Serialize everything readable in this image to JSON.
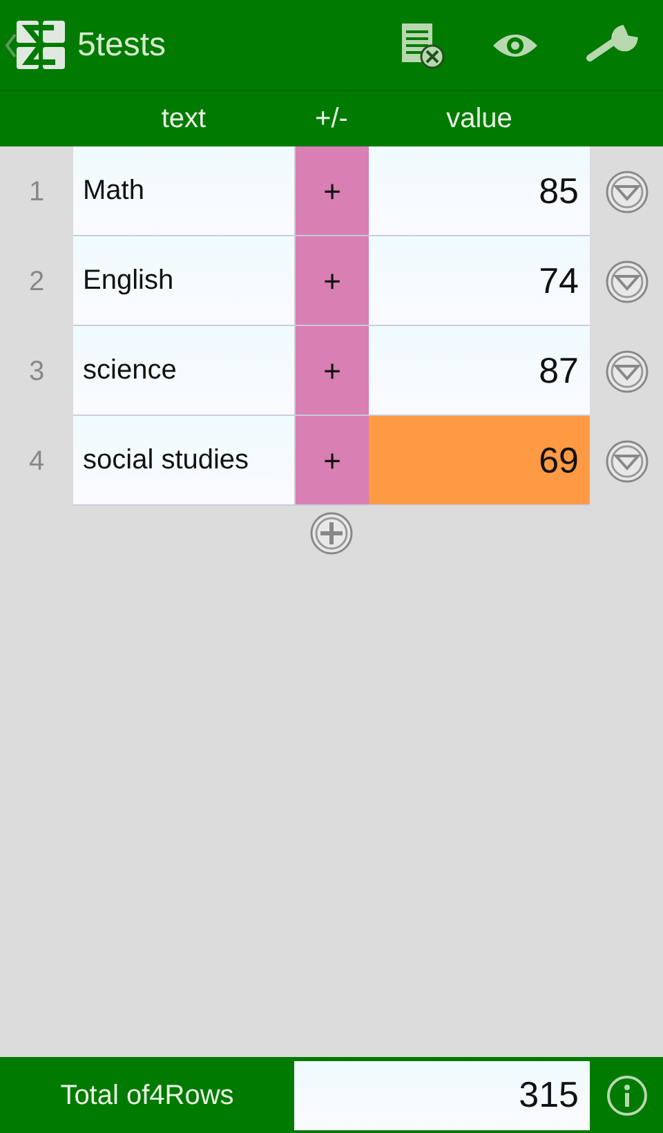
{
  "app_bar": {
    "title": "5tests"
  },
  "columns": [
    "text",
    "+/-",
    "value"
  ],
  "rows": [
    {
      "number": "1",
      "text": "Math",
      "sign": "+",
      "value": "85",
      "highlighted": false
    },
    {
      "number": "2",
      "text": "English",
      "sign": "+",
      "value": "74",
      "highlighted": false
    },
    {
      "number": "3",
      "text": "science",
      "sign": "+",
      "value": "87",
      "highlighted": false
    },
    {
      "number": "4",
      "text": "social studies",
      "sign": "+",
      "value": "69",
      "highlighted": true
    }
  ],
  "footer": {
    "label": "Total of4Rows",
    "total": "315"
  }
}
